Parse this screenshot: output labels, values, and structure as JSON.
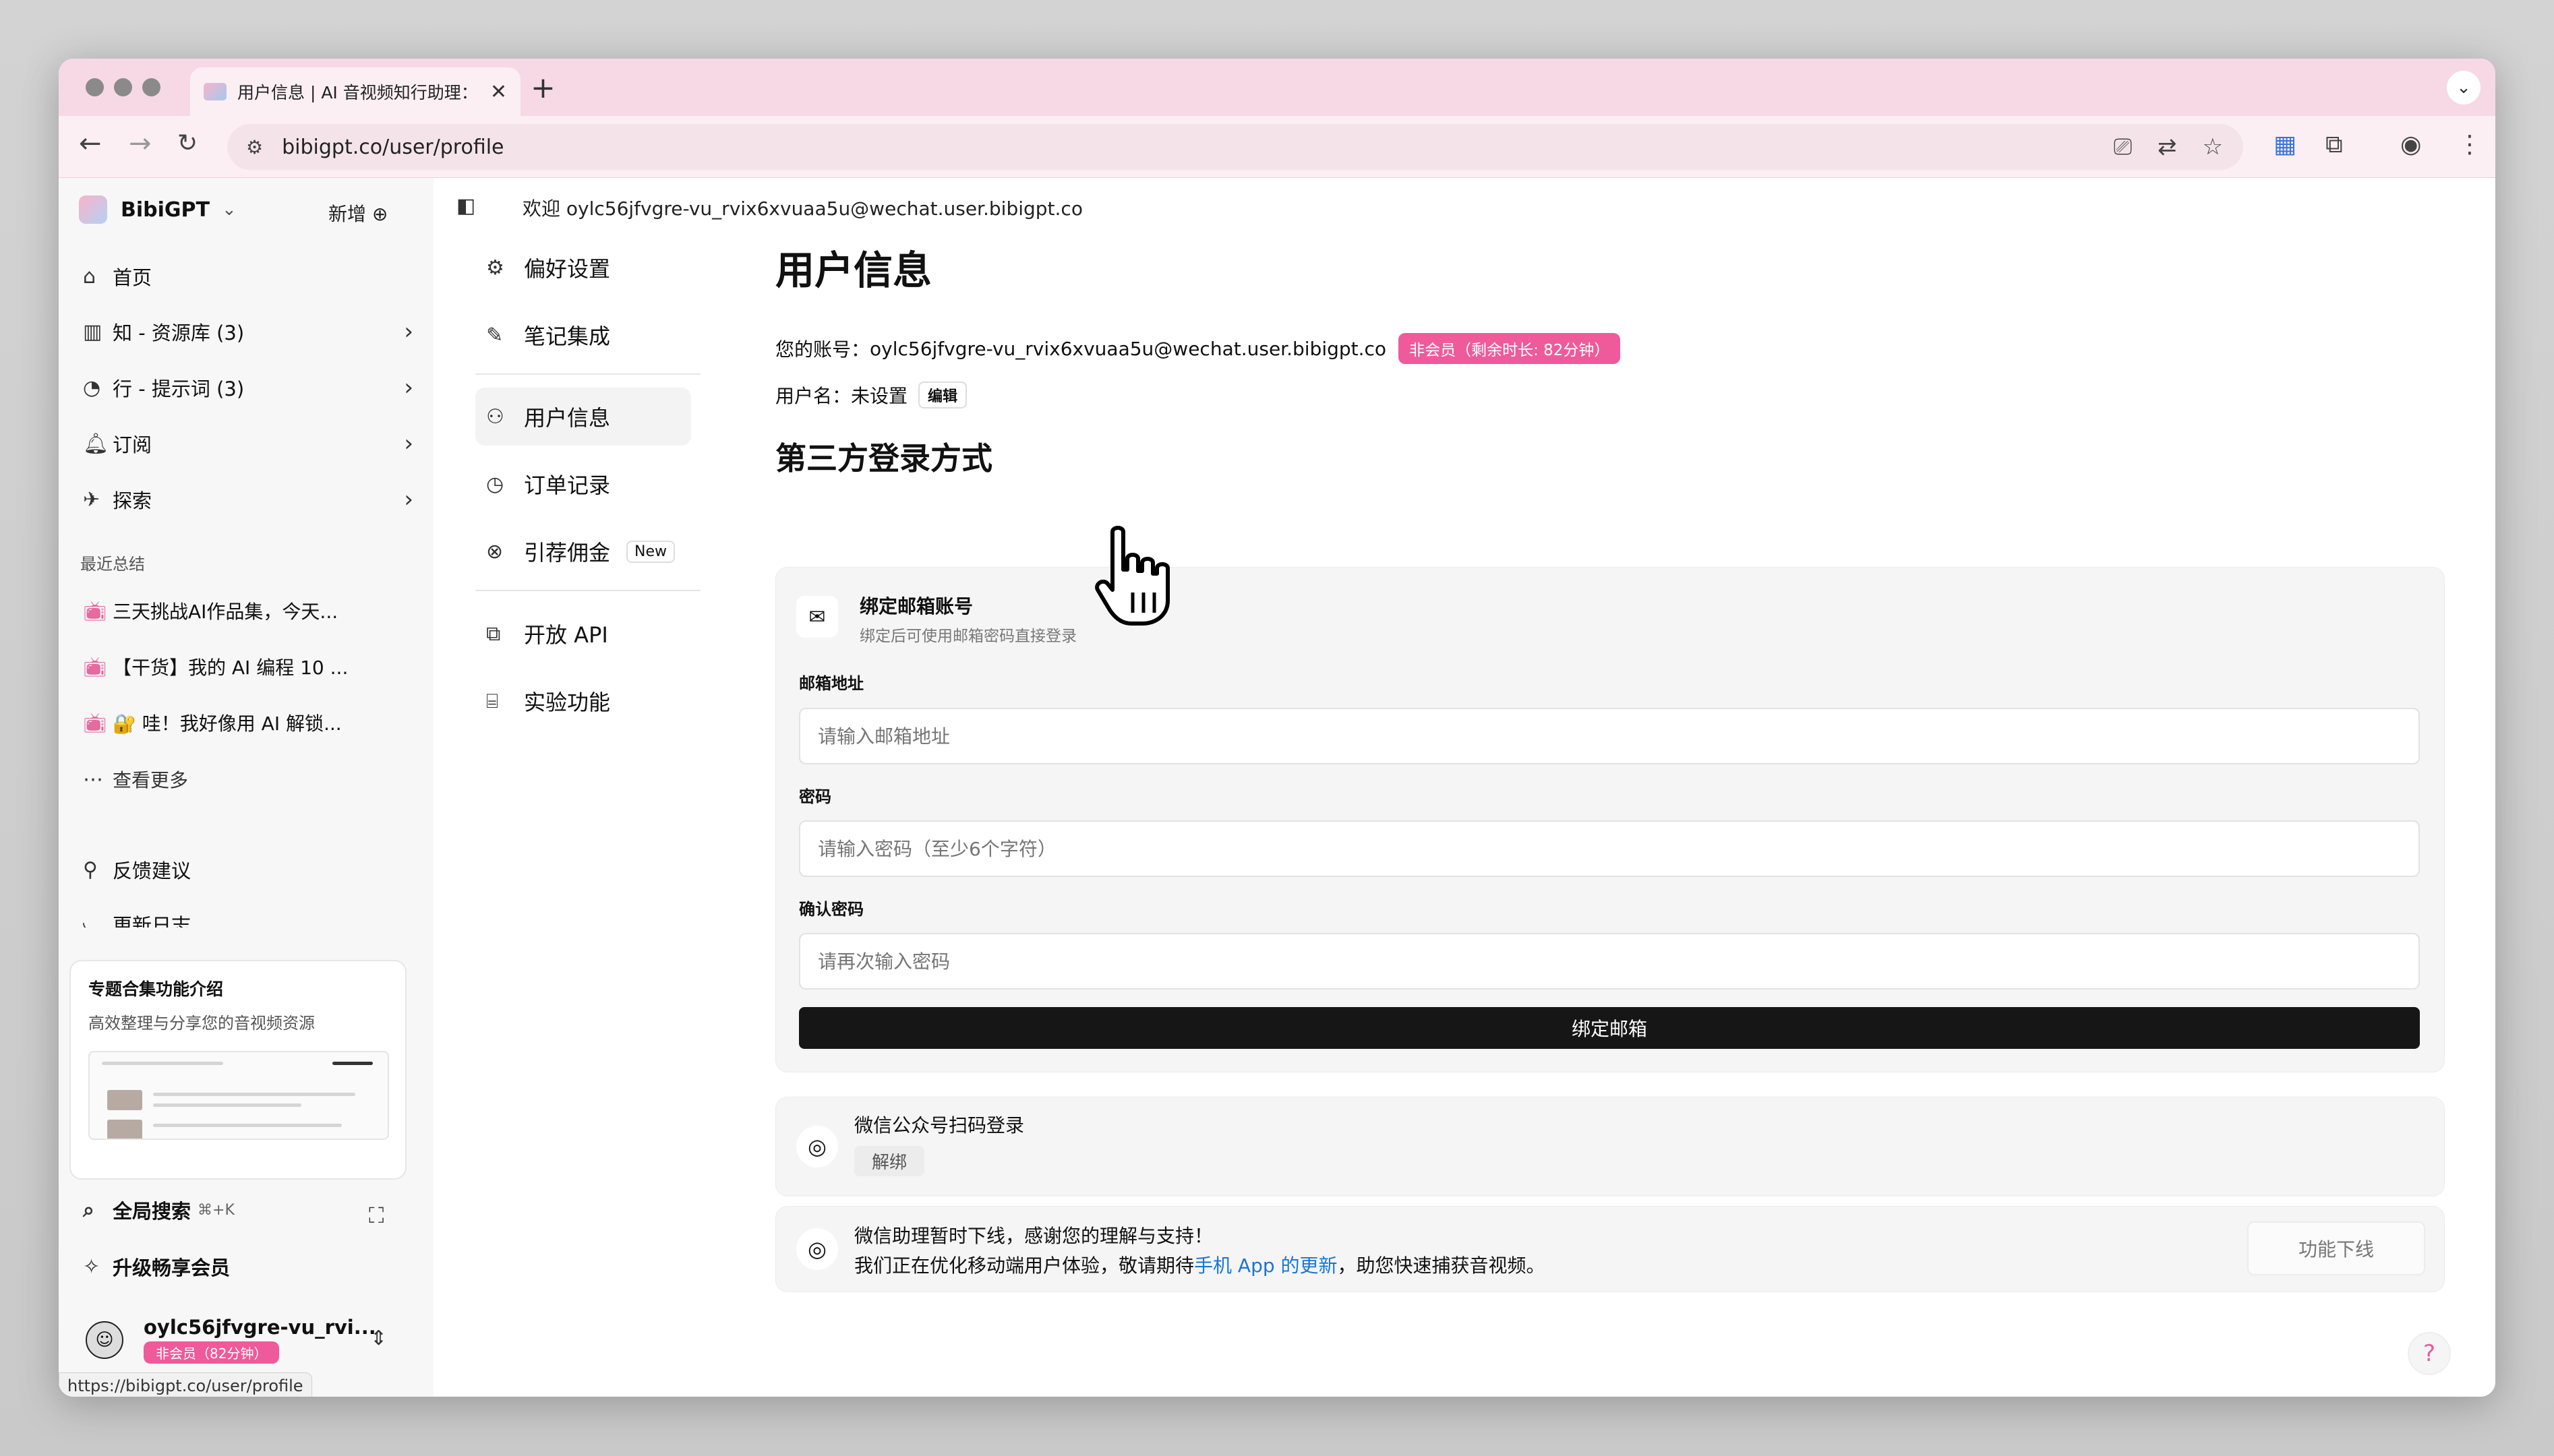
{
  "browser": {
    "tab_title": "用户信息 | AI 音视频知行助理：",
    "tab_close": "✕",
    "new_tab": "+",
    "url": "bibigpt.co/user/profile",
    "status_url": "https://bibigpt.co/user/profile"
  },
  "sidebar": {
    "brand": "BibiGPT",
    "new_label": "新增",
    "nav": [
      {
        "label": "首页",
        "icon": "home-icon"
      },
      {
        "label": "知 - 资源库 (3)",
        "icon": "library-icon"
      },
      {
        "label": "行 - 提示词 (3)",
        "icon": "prompt-icon"
      },
      {
        "label": "订阅",
        "icon": "bell-icon"
      },
      {
        "label": "探索",
        "icon": "telescope-icon"
      }
    ],
    "recent_label": "最近总结",
    "recent": [
      "三天挑战AI作品集，今天...",
      "【干货】我的 AI 编程 10 ...",
      "🔐 哇！我好像用 AI 解锁..."
    ],
    "see_more": "查看更多",
    "feedback": "反馈建议",
    "changelog": "更新日志",
    "promo": {
      "title": "专题合集功能介绍",
      "subtitle": "高效整理与分享您的音视频资源"
    },
    "search_label": "全局搜索",
    "search_shortcut": "⌘+K",
    "upgrade_label": "升级畅享会员",
    "user": {
      "name": "oylc56jfvgre-vu_rvi...",
      "badge": "非会员（82分钟）"
    }
  },
  "main": {
    "welcome": "欢迎 oylc56jfvgre-vu_rvix6xvuaa5u@wechat.user.bibigpt.co",
    "subnav": [
      {
        "label": "偏好设置",
        "icon": "gear-icon"
      },
      {
        "label": "笔记集成",
        "icon": "note-edit-icon"
      },
      {
        "label": "用户信息",
        "icon": "user-icon"
      },
      {
        "label": "订单记录",
        "icon": "clock-icon"
      },
      {
        "label": "引荐佣金",
        "icon": "referral-icon",
        "tag": "New"
      },
      {
        "label": "开放 API",
        "icon": "api-icon"
      },
      {
        "label": "实验功能",
        "icon": "robot-icon"
      }
    ],
    "page_title": "用户信息",
    "account_label": "您的账号：",
    "account_value": "oylc56jfvgre-vu_rvix6xvuaa5u@wechat.user.bibigpt.co",
    "account_badge": "非会员（剩余时长: 82分钟）",
    "username_label": "用户名：未设置",
    "edit_label": "编辑",
    "third_party_title": "第三方登录方式",
    "email_card": {
      "title": "绑定邮箱账号",
      "subtitle": "绑定后可使用邮箱密码直接登录",
      "email_label": "邮箱地址",
      "email_placeholder": "请输入邮箱地址",
      "password_label": "密码",
      "password_placeholder": "请输入密码（至少6个字符）",
      "confirm_label": "确认密码",
      "confirm_placeholder": "请再次输入密码",
      "submit": "绑定邮箱"
    },
    "wechat_card": {
      "title": "微信公众号扫码登录",
      "unbind": "解绑"
    },
    "notice_card": {
      "line1": "微信助理暂时下线，感谢您的理解与支持！",
      "line2_prefix": "我们正在优化移动端用户体验，敬请期待",
      "line2_link": "手机 App 的更新",
      "line2_suffix": "，助您快速捕获音视频。",
      "button": "功能下线"
    },
    "help": "?"
  },
  "colors": {
    "tab_strip": "#f6d9e4",
    "badge_pink": "#ef5a9a",
    "link_blue": "#1976d2",
    "primary_button": "#161616"
  }
}
